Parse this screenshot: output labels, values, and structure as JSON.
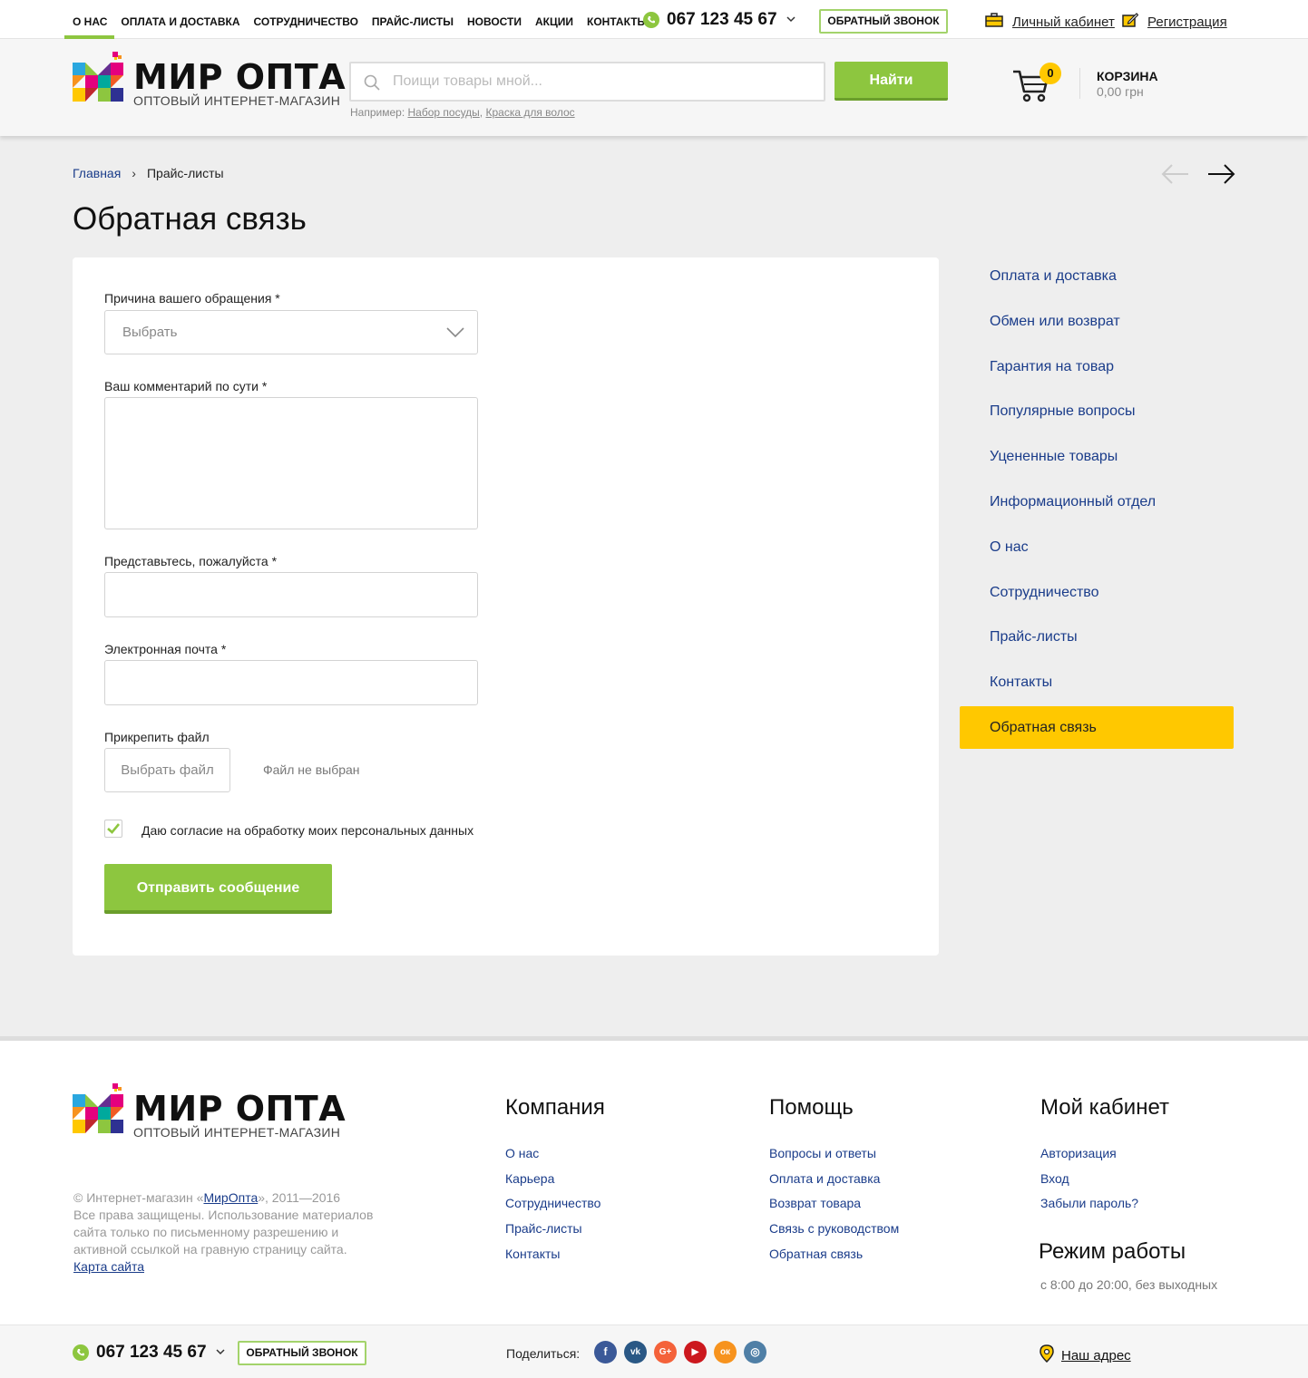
{
  "topnav": {
    "items": [
      {
        "label": "О нас",
        "active": true
      },
      {
        "label": "Оплата и доставка"
      },
      {
        "label": "Сотрудничество"
      },
      {
        "label": "Прайс-листы"
      },
      {
        "label": "Новости"
      },
      {
        "label": "Акции"
      },
      {
        "label": "Контакты"
      }
    ],
    "phone": "067 123 45 67",
    "callback_label": "ОБРАТНЫЙ ЗВОНОК",
    "account_label": "Личный кабинет",
    "register_label": "Регистрация"
  },
  "header": {
    "logo_title": "МИР ОПТА",
    "logo_subtitle": "ОПТОВЫЙ ИНТЕРНЕТ-МАГАЗИН",
    "search_placeholder": "Поищи товары мной...",
    "search_button": "Найти",
    "hint_prefix": "Например:",
    "hint_link_1": "Набор посуды",
    "hint_comma": ",",
    "hint_link_2": "Краска для волос",
    "cart_count": "0",
    "cart_label": "КОРЗИНА",
    "cart_sum": "0,00 грн"
  },
  "breadcrumb": {
    "home": "Главная",
    "separator": "›",
    "current": "Прайс-листы"
  },
  "page_title": "Обратная связь",
  "form": {
    "reason_label": "Причина вашего обращения *",
    "reason_value": "Выбрать",
    "comment_label": "Ваш комментарий по сути *",
    "name_label": "Представьтесь, пожалуйста *",
    "email_label": "Электронная почта *",
    "file_label": "Прикрепить файл",
    "file_button": "Выбрать файл",
    "file_status": "Файл не выбран",
    "consent_label": "Даю согласие на обработку моих персональных данных",
    "consent_checked": true,
    "submit_label": "Отправить сообщение"
  },
  "side_menu": {
    "items": [
      {
        "label": "Оплата и доставка"
      },
      {
        "label": "Обмен или возврат"
      },
      {
        "label": "Гарантия на товар"
      },
      {
        "label": "Популярные вопросы"
      },
      {
        "label": "Уцененные товары"
      },
      {
        "label": "Информационный отдел"
      },
      {
        "label": "О нас"
      },
      {
        "label": "Сотрудничество"
      },
      {
        "label": "Прайс-листы"
      },
      {
        "label": "Контакты"
      },
      {
        "label": "Обратная связь",
        "active": true
      }
    ]
  },
  "footer": {
    "copy_prefix": "© Интернет-магазин «",
    "copy_brand": "МирОпта",
    "copy_suffix": "», 2011—2016",
    "rights": "Все права защищены. Использование материалов сайта только по письменному разрешению и активной ссылкой на гравную страницу сайта.",
    "sitemap": "Карта сайта",
    "company": {
      "title": "Компания",
      "links": [
        "О нас",
        "Карьера",
        "Сотрудничество",
        "Прайс-листы",
        "Контакты"
      ]
    },
    "help": {
      "title": "Помощь",
      "links": [
        "Вопросы и ответы",
        "Оплата и доставка",
        "Возврат товара",
        "Связь с руководством",
        "Обратная связь"
      ]
    },
    "cabinet": {
      "title": "Мой кабинет",
      "links": [
        "Авторизация",
        "Вход",
        "Забыли пароль?"
      ]
    },
    "hours_title": "Режим работы",
    "hours_text": "с 8:00 до 20:00, без выходных"
  },
  "bottombar": {
    "phone": "067 123 45 67",
    "callback_label": "ОБРАТНЫЙ ЗВОНОК",
    "share_label": "Поделиться:",
    "socials": [
      {
        "name": "facebook-icon",
        "glyph": "f",
        "color": "#3b5998"
      },
      {
        "name": "vk-icon",
        "glyph": "vk",
        "color": "#2a5885"
      },
      {
        "name": "google-plus-icon",
        "glyph": "G+",
        "color": "#f4623a"
      },
      {
        "name": "youtube-icon",
        "glyph": "▶",
        "color": "#cc181e"
      },
      {
        "name": "odnoklassniki-icon",
        "glyph": "ок",
        "color": "#f7931e"
      },
      {
        "name": "instagram-icon",
        "glyph": "◎",
        "color": "#4f7fa6"
      }
    ],
    "address_label": "Наш адрес"
  },
  "colors": {
    "accent_green": "#8dc63f",
    "accent_yellow": "#ffc800",
    "link_blue": "#1a3c8a"
  }
}
